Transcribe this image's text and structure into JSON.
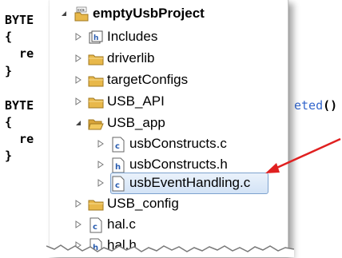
{
  "code": {
    "line1": "BYTE",
    "line2": "{",
    "line3": "  re",
    "line4": "}",
    "line5": "BYTE",
    "line5_tail": "eted",
    "line5_paren": "()",
    "line6": "{",
    "line7": "  re",
    "line8": "}"
  },
  "tree": {
    "project": {
      "label": "emptyUsbProject",
      "icon": "ccs-project-icon"
    },
    "items": [
      {
        "label": "Includes",
        "icon": "includes-icon",
        "expander": "collapsed"
      },
      {
        "label": "driverlib",
        "icon": "folder-icon",
        "expander": "collapsed"
      },
      {
        "label": "targetConfigs",
        "icon": "folder-icon",
        "expander": "collapsed"
      },
      {
        "label": "USB_API",
        "icon": "folder-icon",
        "expander": "collapsed"
      },
      {
        "label": "USB_app",
        "icon": "folder-open-icon",
        "expander": "expanded"
      },
      {
        "label": "usbConstructs.c",
        "icon": "c-file-icon",
        "expander": "collapsed"
      },
      {
        "label": "usbConstructs.h",
        "icon": "h-file-icon",
        "expander": "collapsed"
      },
      {
        "label": "usbEventHandling.c",
        "icon": "c-file-icon",
        "expander": "collapsed",
        "selected": true
      },
      {
        "label": "USB_config",
        "icon": "folder-icon",
        "expander": "collapsed"
      },
      {
        "label": "hal.c",
        "icon": "c-file-icon",
        "expander": "collapsed"
      },
      {
        "label": "hal.h",
        "icon": "h-file-icon",
        "expander": "collapsed"
      }
    ]
  },
  "colors": {
    "folder": "#e8b84a",
    "selection_border": "#7da2ce",
    "arrow": "#e02020",
    "keyword": "#3366cc"
  }
}
